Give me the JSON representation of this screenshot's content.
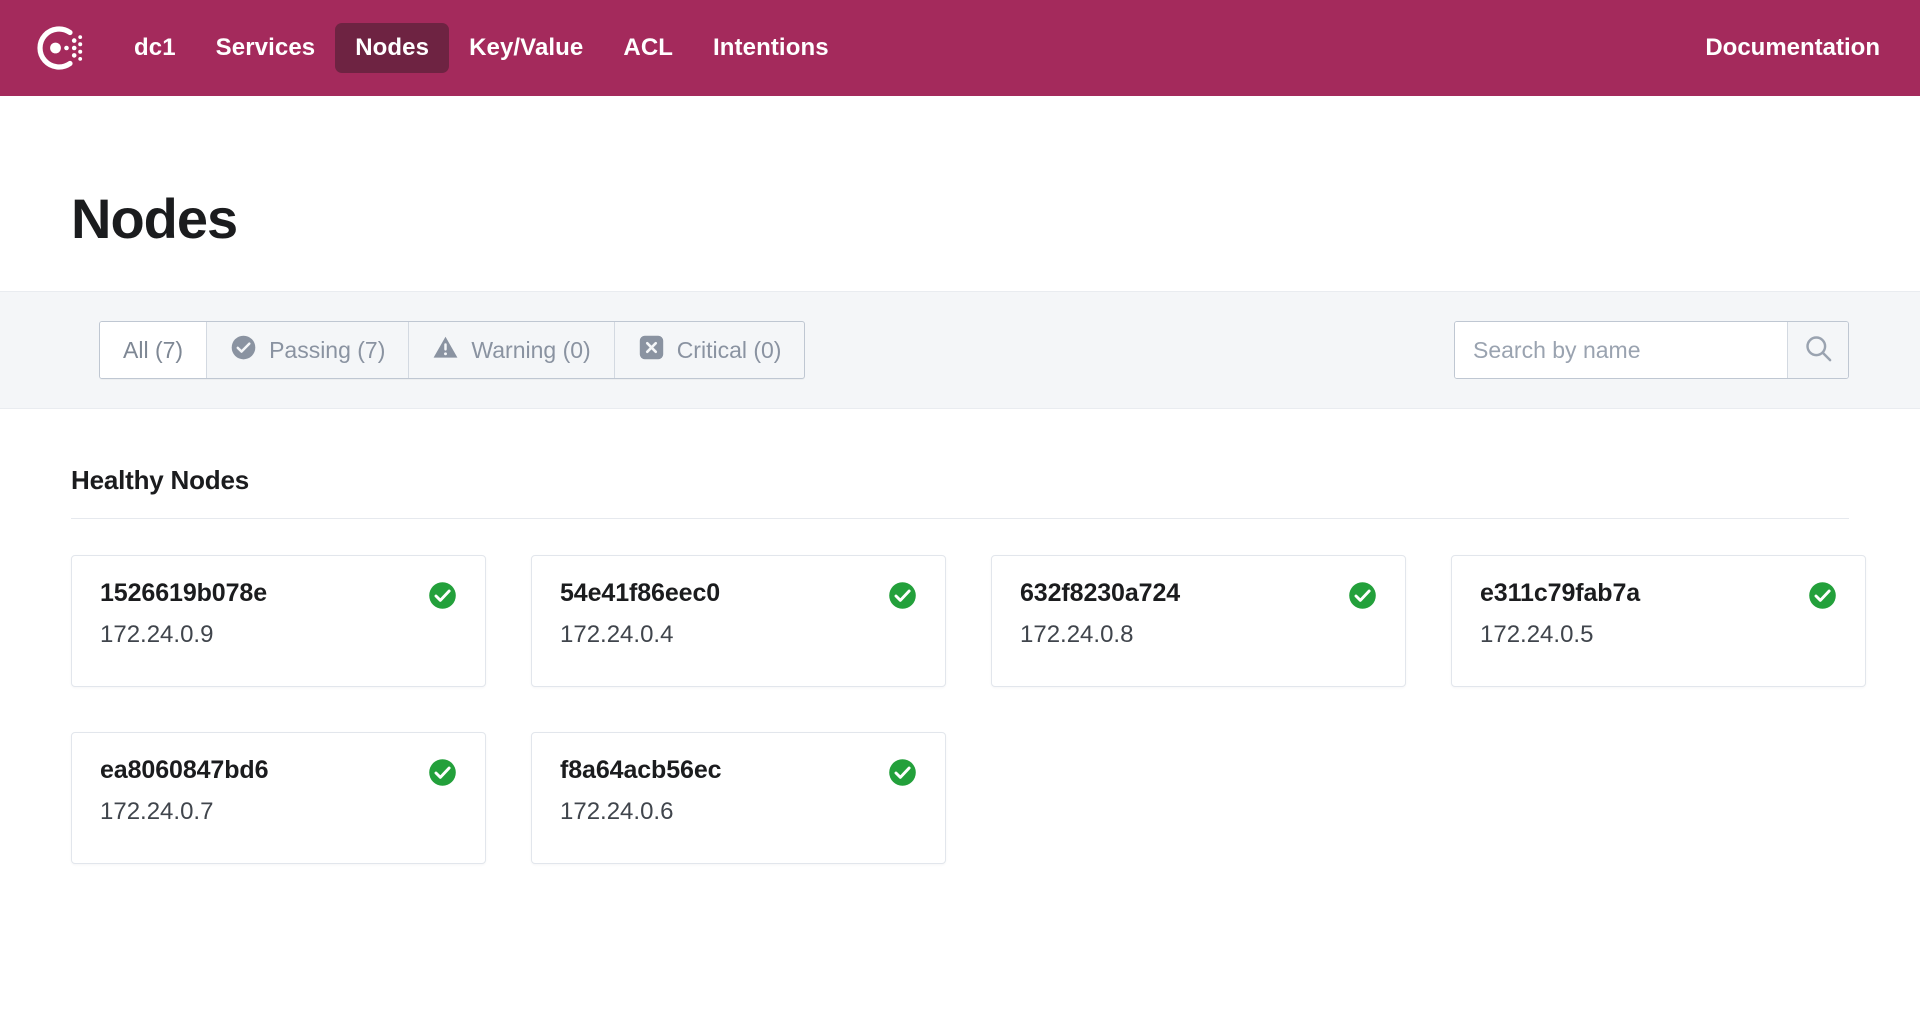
{
  "brand": {
    "logo_icon": "consul-logo-icon",
    "header_bg": "#a42a5c",
    "active_tab_bg": "#6e2342"
  },
  "nav": {
    "datacenter": "dc1",
    "items": [
      {
        "label": "Services",
        "active": false
      },
      {
        "label": "Nodes",
        "active": true
      },
      {
        "label": "Key/Value",
        "active": false
      },
      {
        "label": "ACL",
        "active": false
      },
      {
        "label": "Intentions",
        "active": false
      }
    ],
    "documentation": "Documentation"
  },
  "page": {
    "title": "Nodes"
  },
  "filters": {
    "tabs": [
      {
        "label": "All (7)",
        "icon": "none",
        "active": true
      },
      {
        "label": "Passing (7)",
        "icon": "check-circle-icon",
        "active": false
      },
      {
        "label": "Warning (0)",
        "icon": "warning-triangle-icon",
        "active": false
      },
      {
        "label": "Critical (0)",
        "icon": "x-square-icon",
        "active": false
      }
    ]
  },
  "search": {
    "placeholder": "Search by name",
    "value": "",
    "icon": "search-icon"
  },
  "section": {
    "heading": "Healthy Nodes"
  },
  "nodes": [
    {
      "name": "1526619b078e",
      "ip": "172.24.0.9",
      "status": "passing",
      "status_color": "#23a03b"
    },
    {
      "name": "54e41f86eec0",
      "ip": "172.24.0.4",
      "status": "passing",
      "status_color": "#23a03b"
    },
    {
      "name": "632f8230a724",
      "ip": "172.24.0.8",
      "status": "passing",
      "status_color": "#23a03b"
    },
    {
      "name": "e311c79fab7a",
      "ip": "172.24.0.5",
      "status": "passing",
      "status_color": "#23a03b"
    },
    {
      "name": "ea8060847bd6",
      "ip": "172.24.0.7",
      "status": "passing",
      "status_color": "#23a03b"
    },
    {
      "name": "f8a64acb56ec",
      "ip": "172.24.0.6",
      "status": "passing",
      "status_color": "#23a03b"
    }
  ]
}
